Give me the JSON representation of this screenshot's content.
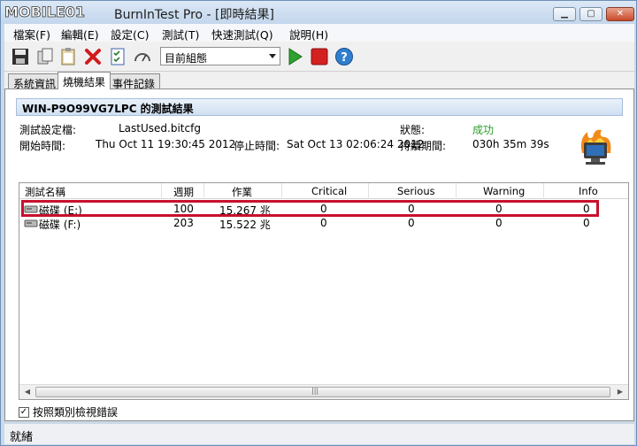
{
  "watermark": "MOBILE01",
  "window": {
    "title": "BurnInTest Pro - [即時結果]"
  },
  "menu": [
    "檔案(F)",
    "編輯(E)",
    "設定(C)",
    "測試(T)",
    "快速測試(Q)",
    "說明(H)"
  ],
  "toolbar": {
    "icons": [
      "save-icon",
      "copy-icon",
      "clipboard-icon",
      "delete-icon",
      "checklist-icon",
      "gauge-icon",
      "play-icon",
      "stop-icon",
      "help-icon"
    ],
    "select_value": "目前組態"
  },
  "tabs": [
    "系統資訊",
    "燒機結果",
    "事件記錄"
  ],
  "results": {
    "header": "WIN-P9O99VG7LPC 的測試結果",
    "config_label": "測試設定檔:",
    "config_value": "LastUsed.bitcfg",
    "status_label": "狀態:",
    "status_value": "成功",
    "start_label": "開始時間:",
    "start_value": "Thu Oct 11 19:30:45 2012",
    "stop_label": "停止時間:",
    "stop_value": "Sat Oct 13 02:06:24 2012",
    "duration_label": "持續期間:",
    "duration_value": "030h 35m 39s"
  },
  "grid": {
    "columns": [
      "測試名稱",
      "週期",
      "作業",
      "Critical",
      "Serious",
      "Warning",
      "Info"
    ],
    "rows": [
      {
        "name": "磁碟 (E:)",
        "cycles": "100",
        "ops": "15.267 兆",
        "critical": "0",
        "serious": "0",
        "warning": "0",
        "info": "0"
      },
      {
        "name": "磁碟 (F:)",
        "cycles": "203",
        "ops": "15.522 兆",
        "critical": "0",
        "serious": "0",
        "warning": "0",
        "info": "0"
      }
    ]
  },
  "checkbox": {
    "label": "按照類別檢視錯誤",
    "checked": true
  },
  "status_bar": "就緒",
  "colors": {
    "success": "#2a9d2a",
    "highlight": "#c8102e",
    "header_bar": "#cfdff1"
  }
}
